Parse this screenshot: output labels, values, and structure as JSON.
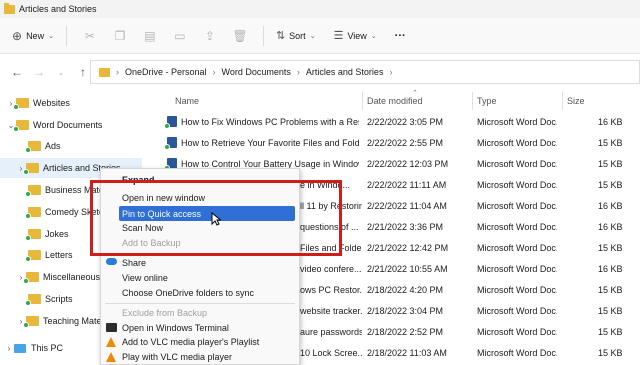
{
  "window": {
    "title": "Articles and Stories"
  },
  "toolbar": {
    "new_label": "New",
    "sort_label": "Sort",
    "view_label": "View",
    "more_label": "···"
  },
  "address": {
    "crumbs": [
      "OneDrive - Personal",
      "Word Documents",
      "Articles and Stories"
    ]
  },
  "nav": {
    "items": [
      {
        "label": "Websites",
        "expanded": false
      },
      {
        "label": "Word Documents",
        "expanded": true
      },
      {
        "label": "Ads"
      },
      {
        "label": "Articles and Stories",
        "selected": true
      },
      {
        "label": "Business Materi"
      },
      {
        "label": "Comedy Sketch"
      },
      {
        "label": "Jokes"
      },
      {
        "label": "Letters"
      },
      {
        "label": "Miscellaneous"
      },
      {
        "label": "Scripts"
      },
      {
        "label": "Teaching Materi"
      },
      {
        "label": "This PC"
      }
    ]
  },
  "columns": {
    "name": "Name",
    "date": "Date modified",
    "type": "Type",
    "size": "Size"
  },
  "files": [
    {
      "name": "How to Fix Windows PC Problems with a Restor...",
      "date": "2/22/2022 3:05 PM",
      "type": "Microsoft Word Doc...",
      "size": "16 KB"
    },
    {
      "name": "How to Retrieve Your Favorite Files and Folders ...",
      "date": "2/22/2022 2:55 PM",
      "type": "Microsoft Word Doc...",
      "size": "15 KB"
    },
    {
      "name": "How to Control Your Battery Usage in Windows...",
      "date": "2/22/2022 12:03 PM",
      "type": "Microsoft Word Doc...",
      "size": "15 KB"
    },
    {
      "name": "e in Windo...",
      "date": "2/22/2022 11:11 AM",
      "type": "Microsoft Word Doc...",
      "size": "15 KB"
    },
    {
      "name": "ll 11 by Restorin...",
      "date": "2/22/2022 11:04 AM",
      "type": "Microsoft Word Doc...",
      "size": "16 KB"
    },
    {
      "name": "questions of ...",
      "date": "2/21/2022 3:36 PM",
      "type": "Microsoft Word Doc...",
      "size": "16 KB"
    },
    {
      "name": "Files and Folde...",
      "date": "2/21/2022 12:42 PM",
      "type": "Microsoft Word Doc...",
      "size": "15 KB"
    },
    {
      "name": "video confere...",
      "date": "2/21/2022 10:55 AM",
      "type": "Microsoft Word Doc...",
      "size": "16 KB"
    },
    {
      "name": "ows PC Restor...",
      "date": "2/18/2022 4:20 PM",
      "type": "Microsoft Word Doc...",
      "size": "15 KB"
    },
    {
      "name": "website tracker...",
      "date": "2/18/2022 3:04 PM",
      "type": "Microsoft Word Doc...",
      "size": "15 KB"
    },
    {
      "name": "aure passwords...",
      "date": "2/18/2022 2:52 PM",
      "type": "Microsoft Word Doc...",
      "size": "15 KB"
    },
    {
      "name": "10 Lock Scree...",
      "date": "2/18/2022 11:03 AM",
      "type": "Microsoft Word Doc...",
      "size": "15 KB"
    }
  ],
  "context_menu": {
    "expand": "Expand",
    "open_new_window": "Open in new window",
    "pin_quick_access": "Pin to Quick access",
    "scan_now": "Scan Now",
    "add_to_backup": "Add to Backup",
    "share": "Share",
    "view_online": "View online",
    "choose_folders": "Choose OneDrive folders to sync",
    "exclude_backup": "Exclude from Backup",
    "open_terminal": "Open in Windows Terminal",
    "add_vlc_playlist": "Add to VLC media player's Playlist",
    "play_vlc": "Play with VLC media player"
  },
  "colors": {
    "accent": "#2f6fd6",
    "highlight_box": "#d21b1b",
    "folder": "#e8b83a",
    "word": "#2b579a",
    "sync": "#2fa84f"
  }
}
